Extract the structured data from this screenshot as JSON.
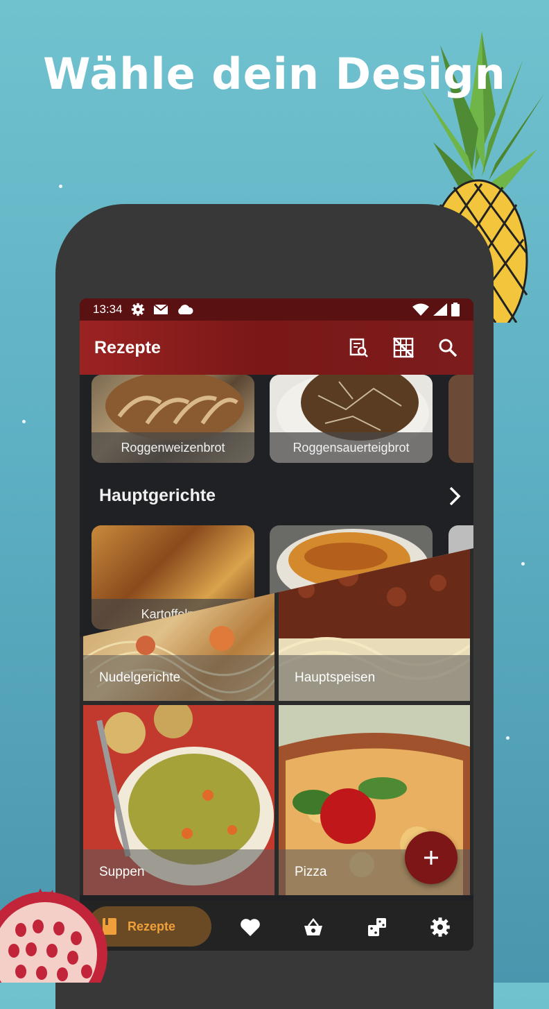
{
  "headline": "Wähle dein Design",
  "status_bar": {
    "time": "13:34"
  },
  "app_bar": {
    "title": "Rezepte",
    "actions": [
      "recipe-search-icon",
      "grid-off-icon",
      "search-icon"
    ]
  },
  "top_row": {
    "cards": [
      {
        "label": "Roggenweizenbrot"
      },
      {
        "label": "Roggensauerteigbrot"
      }
    ]
  },
  "section": {
    "title": "Hauptgerichte",
    "cards": [
      {
        "label": "Kartoffelp..."
      }
    ]
  },
  "category_grid": [
    {
      "label": "Nudelgerichte"
    },
    {
      "label": "Hauptspeisen"
    },
    {
      "label": "Suppen"
    },
    {
      "label": "Pizza"
    }
  ],
  "fab": {
    "icon": "plus-icon"
  },
  "bottom_nav": {
    "active_label": "Rezepte",
    "items": [
      "book-icon",
      "heart-icon",
      "basket-icon",
      "dice-icon",
      "settings-icon"
    ]
  },
  "colors": {
    "background": "#5eb0c3",
    "app_bar": "#8b1e1e",
    "accent": "#f0a03a",
    "fab": "#7d1616"
  }
}
